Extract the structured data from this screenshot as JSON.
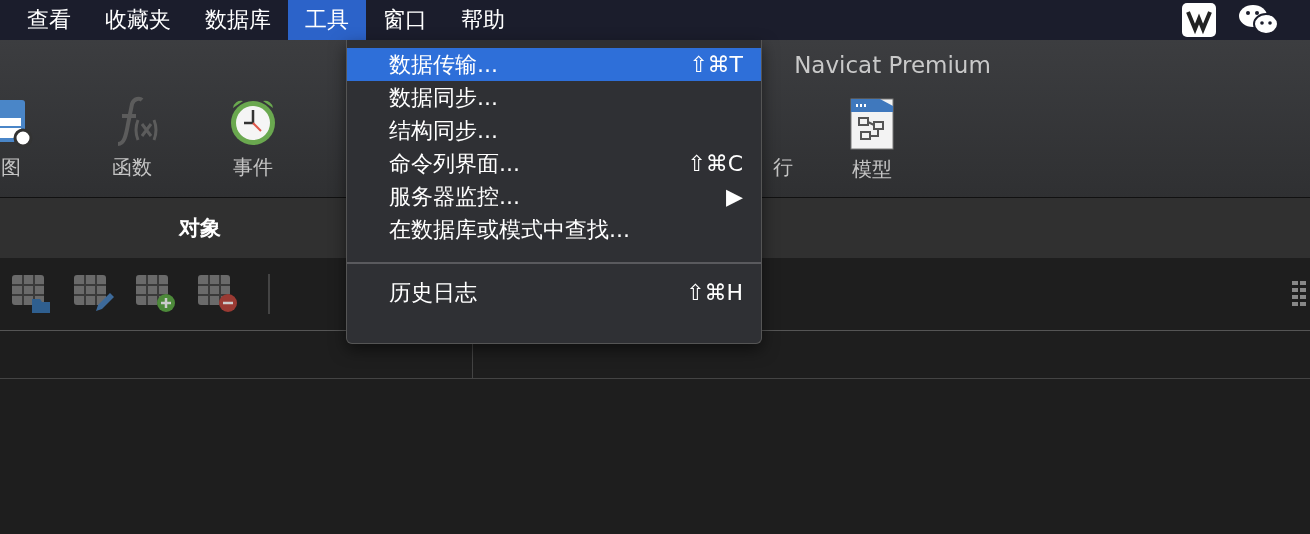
{
  "menu_bar": {
    "items": [
      {
        "label": "查看",
        "selected": false
      },
      {
        "label": "收藏夹",
        "selected": false
      },
      {
        "label": "数据库",
        "selected": false
      },
      {
        "label": "工具",
        "selected": true
      },
      {
        "label": "窗口",
        "selected": false
      },
      {
        "label": "帮助",
        "selected": false
      }
    ]
  },
  "dropdown": {
    "items": [
      {
        "kind": "item",
        "label": "数据传输...",
        "shortcut": "⇧⌘T",
        "selected": true
      },
      {
        "kind": "item",
        "label": "数据同步...",
        "selected": false
      },
      {
        "kind": "item",
        "label": "结构同步...",
        "selected": false
      },
      {
        "kind": "item",
        "label": "命令列界面...",
        "shortcut": "⇧⌘C",
        "selected": false
      },
      {
        "kind": "item",
        "label": "服务器监控...",
        "arrow": "▶",
        "selected": false
      },
      {
        "kind": "item",
        "label": "在数据库或模式中查找...",
        "selected": false
      },
      {
        "kind": "separator"
      },
      {
        "kind": "item",
        "label": "历史日志",
        "shortcut": "⇧⌘H",
        "selected": false
      }
    ]
  },
  "window": {
    "title": "Navicat Premium"
  },
  "toolbar": {
    "left": [
      {
        "kind": "view",
        "label": "图"
      },
      {
        "kind": "function",
        "label": "函数"
      },
      {
        "kind": "event",
        "label": "事件"
      }
    ],
    "right": [
      {
        "kind": "run",
        "label": "行"
      },
      {
        "kind": "model",
        "label": "模型"
      }
    ]
  },
  "tabs": [
    {
      "label": "对象",
      "selected": true
    }
  ]
}
